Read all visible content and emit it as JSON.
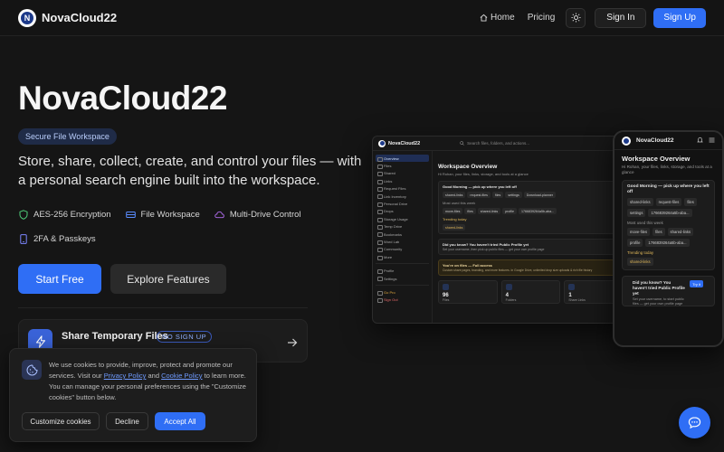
{
  "nav": {
    "brand": "NovaCloud22",
    "logo_letter": "N",
    "home": "Home",
    "pricing": "Pricing",
    "signin": "Sign In",
    "signup": "Sign Up"
  },
  "hero": {
    "title": "NovaCloud22",
    "pill": "Secure File Workspace",
    "tagline": "Store, share, collect, create, and control your files — with a personal search engine built into the workspace.",
    "features": [
      "AES-256 Encryption",
      "File Workspace",
      "Multi-Drive Control",
      "2FA & Passkeys"
    ],
    "cta_primary": "Start Free",
    "cta_secondary": "Explore Features"
  },
  "share_card": {
    "title": "Share Temporary Files",
    "badge": "NO SIGN UP"
  },
  "cookie": {
    "text_1": "We use cookies to provide, improve, protect and promote our services. Visit our ",
    "privacy_link": "Privacy Policy",
    "text_2": " and ",
    "cookie_link": "Cookie Policy",
    "text_3": " to learn more. You can manage your personal preferences using the \"Customize cookies\" button below.",
    "customize": "Customize cookies",
    "decline": "Decline",
    "accept": "Accept All"
  },
  "desktop": {
    "brand": "NovaCloud22",
    "search_placeholder": "Search files, folders, and actions...",
    "sidebar": [
      "Overview",
      "Files",
      "Shared",
      "Links",
      "Request Files",
      "Link Inventory",
      "Personal Drive",
      "Drops",
      "Storage Usage",
      "Temp Drive",
      "Bookmarks",
      "Word Lab",
      "Community",
      "More",
      "Profile",
      "Settings",
      "Go Pro",
      "Sign Out"
    ],
    "title": "Workspace Overview",
    "subtitle": "Hi Rohan, your files, links, storage, and tools at a glance",
    "greeting": "Good Morning — pick up where you left off",
    "chips_1": [
      "shared-links",
      "request-files",
      "files",
      "settings",
      "Download-planner"
    ],
    "section_2": "Most used this week",
    "chips_2": [
      "move-files",
      "files",
      "shared-links",
      "profile",
      "1766839264a5b-aba..."
    ],
    "section_3": "Trending today",
    "chips_3": [
      "shared-links"
    ],
    "tip_title": "Did you know? You haven't tried Public Profile yet",
    "tip_sub": "Set your username, then pick up public files — get your own profile page",
    "offline_title": "You're on files — Full access",
    "offline_sub": "Custom share pages, branding, and more features. In Google Drive, unlimited drop size uploads & rich file history",
    "stats": [
      {
        "num": "96",
        "label": "Files"
      },
      {
        "num": "4",
        "label": "Folders"
      },
      {
        "num": "1",
        "label": "Share Links"
      }
    ]
  },
  "phone": {
    "brand": "NovaCloud22",
    "title": "Workspace Overview",
    "subtitle": "Hi Rohan, your files, links, storage, and tools at a glance",
    "greeting": "Good Morning — pick up where you left off",
    "chips_1": [
      "shared-links",
      "request-files",
      "files",
      "settings",
      "1766839264a5b-aba..."
    ],
    "section_2": "Most used this week",
    "chips_2": [
      "move-files",
      "files",
      "shared-links",
      "profile",
      "1766839264a5b-aba..."
    ],
    "section_3": "Trending today",
    "chips_3": [
      "shared-links"
    ],
    "tip_title": "Did you know? You haven't tried Public Profile yet",
    "tip_sub": "Set your username, to start public files — get your own profile page",
    "try_it": "Try it"
  },
  "colors": {
    "accent": "#2f6ef5",
    "background": "#151515",
    "card": "#1c1c1c"
  }
}
